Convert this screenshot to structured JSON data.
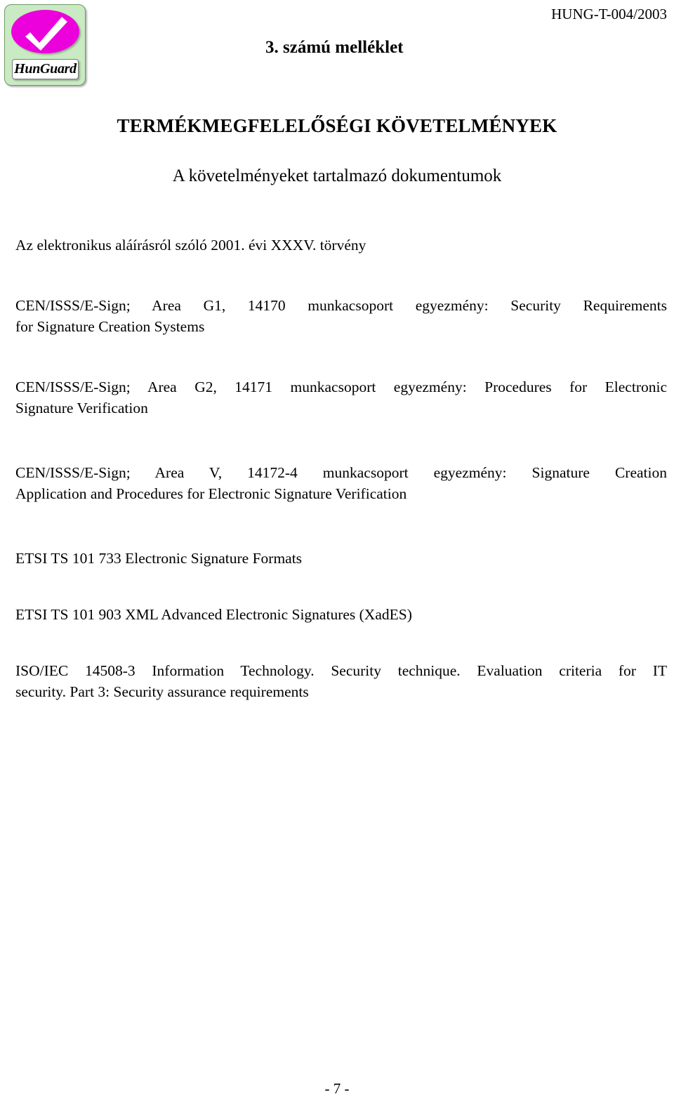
{
  "header": {
    "doc_code": "HUNG-T-004/2003",
    "annex_title": "3. számú melléklet",
    "logo": {
      "label": "HunGuard",
      "bg_color": "#c9eac2",
      "ellipse_color": "#ec00dc",
      "check_color": "#ffffff"
    }
  },
  "titles": {
    "main": "TERMÉKMEGFELELŐSÉGI KÖVETELMÉNYEK",
    "sub": "A követelményeket tartalmazó dokumentumok"
  },
  "documents": [
    {
      "id": "eat-2001-xxxv",
      "lines": [
        "Az elektronikus aláírásról szóló 2001. évi XXXV. törvény"
      ]
    },
    {
      "id": "cen-isss-area-g1",
      "lines": [
        "CEN/ISSS/E-Sign; Area G1, 14170 munkacsoport egyezmény: Security Requirements",
        "for Signature Creation Systems"
      ]
    },
    {
      "id": "cen-isss-area-g2",
      "lines": [
        "CEN/ISSS/E-Sign; Area G2, 14171 munkacsoport egyezmény: Procedures for Electronic",
        "Signature Verification"
      ]
    },
    {
      "id": "cen-isss-area-v",
      "lines": [
        "CEN/ISSS/E-Sign; Area V, 14172-4 munkacsoport egyezmény: Signature Creation",
        "Application and Procedures for Electronic Signature Verification"
      ]
    },
    {
      "id": "etsi-ts-101-733",
      "lines": [
        "ETSI TS 101 733 Electronic Signature Formats"
      ]
    },
    {
      "id": "etsi-ts-101-903",
      "lines": [
        "ETSI TS 101 903 XML Advanced Electronic Signatures (XadES)"
      ]
    },
    {
      "id": "iso-iec-14508-3",
      "lines": [
        "ISO/IEC 14508-3 Information Technology. Security technique. Evaluation criteria for IT",
        "security. Part 3: Security assurance requirements"
      ]
    }
  ],
  "footer": {
    "page_number": "- 7 -"
  }
}
